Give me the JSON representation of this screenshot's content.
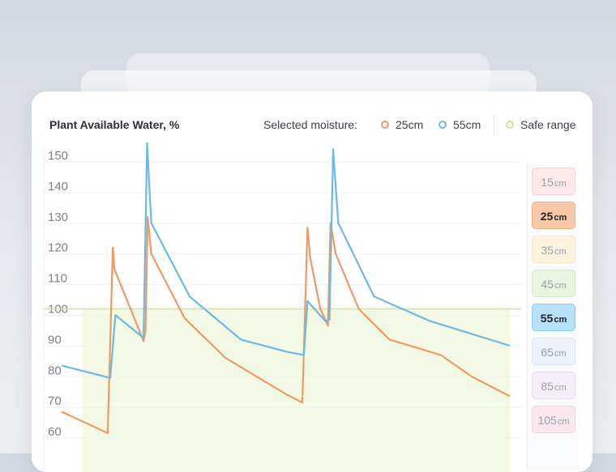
{
  "chart_data": {
    "type": "line",
    "title": "Plant Available Water, %",
    "legend_label": "Selected moisture:",
    "ylim": [
      55,
      155
    ],
    "yticks": [
      150,
      140,
      130,
      120,
      110,
      100,
      90,
      80,
      70,
      60
    ],
    "safe_range": {
      "label": "Safe range",
      "min": 55,
      "max": 100,
      "color": "#cfe59a"
    },
    "series": [
      {
        "name": "25cm",
        "color": "#ee9a66",
        "points": [
          [
            0,
            66.5
          ],
          [
            0.9,
            59.5
          ],
          [
            1.0,
            120
          ],
          [
            1.03,
            113
          ],
          [
            1.6,
            89.5
          ],
          [
            1.64,
            93
          ],
          [
            1.68,
            130
          ],
          [
            1.75,
            118
          ],
          [
            2.4,
            97
          ],
          [
            3.2,
            84
          ],
          [
            4.4,
            72
          ],
          [
            4.7,
            69.5
          ],
          [
            4.8,
            126.5
          ],
          [
            4.85,
            117
          ],
          [
            5.05,
            100
          ],
          [
            5.2,
            94.5
          ],
          [
            5.25,
            128
          ],
          [
            5.35,
            118
          ],
          [
            5.8,
            100
          ],
          [
            6.4,
            90
          ],
          [
            7.4,
            85
          ],
          [
            8.0,
            78
          ],
          [
            8.75,
            71.5
          ]
        ]
      },
      {
        "name": "55cm",
        "color": "#6cb9e6",
        "points": [
          [
            0,
            81.5
          ],
          [
            0.95,
            77.5
          ],
          [
            1.05,
            98
          ],
          [
            1.6,
            90.5
          ],
          [
            1.67,
            154
          ],
          [
            1.75,
            128
          ],
          [
            2.5,
            104
          ],
          [
            3.5,
            90
          ],
          [
            4.4,
            86
          ],
          [
            4.73,
            85
          ],
          [
            4.8,
            102.5
          ],
          [
            5.15,
            96
          ],
          [
            5.23,
            96.5
          ],
          [
            5.3,
            152
          ],
          [
            5.4,
            128
          ],
          [
            6.1,
            104
          ],
          [
            7.2,
            96
          ],
          [
            8.75,
            88
          ]
        ]
      }
    ]
  },
  "depth_selector": {
    "items": [
      {
        "value": "15",
        "unit": "cm",
        "bg": "#fde9e9",
        "border": "#f6d4d4",
        "active": false
      },
      {
        "value": "25",
        "unit": "cm",
        "bg": "#f8c9a9",
        "border": "#f0b08a",
        "active": true
      },
      {
        "value": "35",
        "unit": "cm",
        "bg": "#fdf3df",
        "border": "#f5e6c4",
        "active": false
      },
      {
        "value": "45",
        "unit": "cm",
        "bg": "#eaf5df",
        "border": "#d9ecc7",
        "active": false
      },
      {
        "value": "55",
        "unit": "cm",
        "bg": "#b7e0f9",
        "border": "#8ecdf3",
        "active": true
      },
      {
        "value": "65",
        "unit": "cm",
        "bg": "#eef3fb",
        "border": "#dde5f3",
        "active": false
      },
      {
        "value": "85",
        "unit": "cm",
        "bg": "#f6eef9",
        "border": "#e9dcf1",
        "active": false
      },
      {
        "value": "105",
        "unit": "cm",
        "bg": "#fbe8ee",
        "border": "#f3d2dc",
        "active": false
      }
    ]
  }
}
